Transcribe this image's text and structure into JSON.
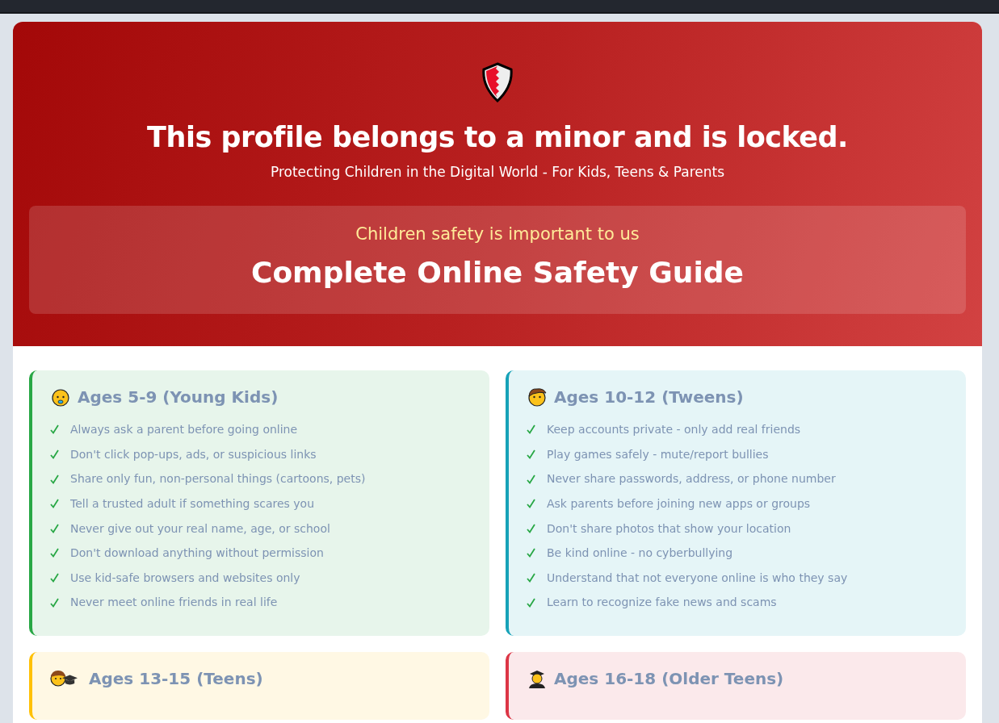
{
  "header": {
    "title": "This profile belongs to a minor and is locked.",
    "subtitle": "Protecting Children in the Digital World - For Kids, Teens & Parents",
    "banner": {
      "tagline": "Children safety is important to us",
      "title": "Complete Online Safety Guide"
    }
  },
  "age_groups": [
    {
      "kind": "baby",
      "color": "#28a745",
      "title": "Ages 5-9 (Young Kids)",
      "items": [
        "Always ask a parent before going online",
        "Don't click pop-ups, ads, or suspicious links",
        "Share only fun, non-personal things (cartoons, pets)",
        "Tell a trusted adult if something scares you",
        "Never give out your real name, age, or school",
        "Don't download anything without permission",
        "Use kid-safe browsers and websites only",
        "Never meet online friends in real life"
      ]
    },
    {
      "kind": "child",
      "color": "#17a2b8",
      "title": "Ages 10-12 (Tweens)",
      "items": [
        "Keep accounts private - only add real friends",
        "Play games safely - mute/report bullies",
        "Never share passwords, address, or phone number",
        "Ask parents before joining new apps or groups",
        "Don't share photos that show your location",
        "Be kind online - no cyberbullying",
        "Understand that not everyone online is who they say",
        "Learn to recognize fake news and scams"
      ]
    },
    {
      "kind": "teen",
      "color": "#ffc107",
      "title": "Ages 13-15 (Teens)"
    },
    {
      "kind": "graduate",
      "color": "#dc3545",
      "title": "Ages 16-18 (Older Teens)"
    }
  ]
}
